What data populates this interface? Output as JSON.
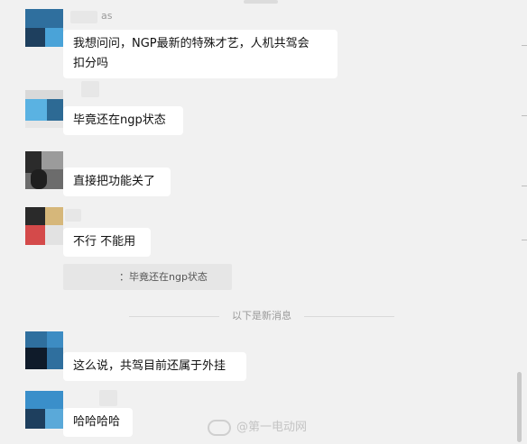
{
  "messages": [
    {
      "sender": "as",
      "text": "我想问问，NGP最新的特殊才艺，人机共驾会\n扣分吗"
    },
    {
      "sender": "",
      "text": "毕竟还在ngp状态"
    },
    {
      "sender": "",
      "text": "直接把功能关了"
    },
    {
      "sender": "",
      "text": "不行 不能用"
    },
    {
      "sender": "",
      "text": "这么说，共驾目前还属于外挂"
    },
    {
      "sender": "",
      "text": "哈哈哈哈"
    }
  ],
  "quote": {
    "text": "：毕竟还在ngp状态"
  },
  "divider": {
    "text": "以下是新消息"
  },
  "watermark": {
    "text": "@第一电动网"
  },
  "colors": {
    "background": "#f1f1f1",
    "bubble": "#ffffff",
    "quote_bg": "#e6e6e6",
    "muted_text": "#9a9a9a"
  }
}
